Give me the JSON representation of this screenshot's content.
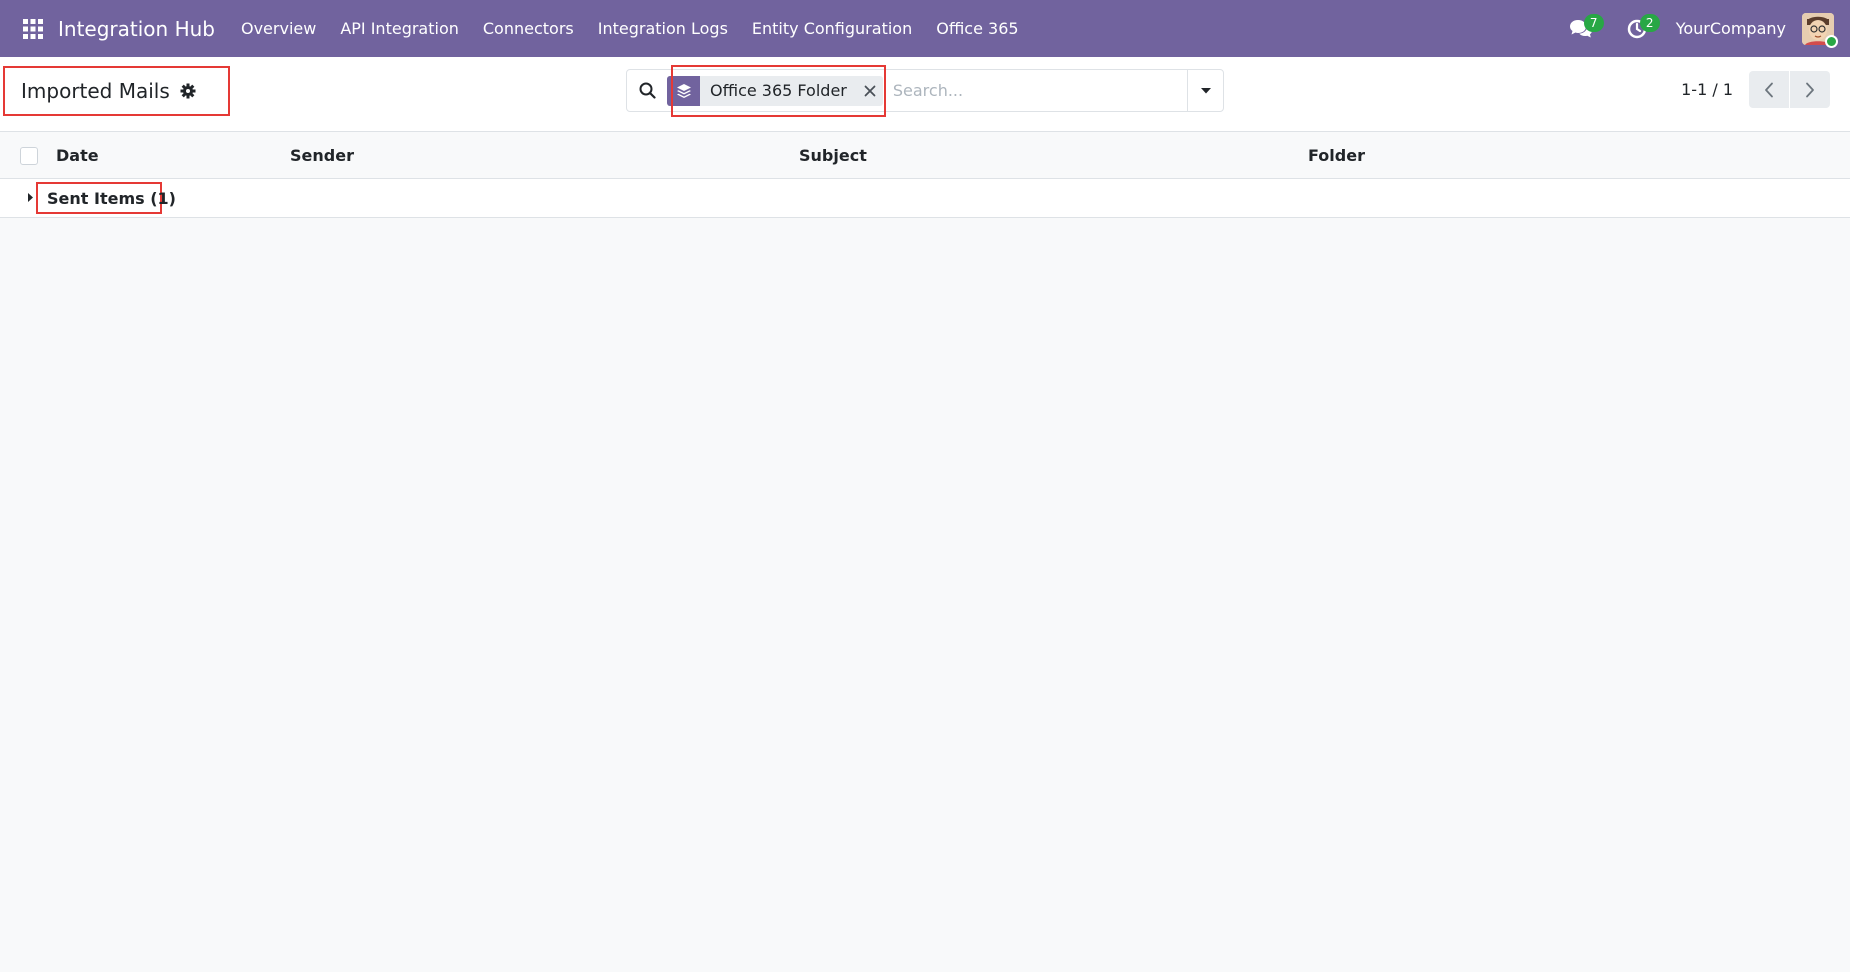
{
  "navbar": {
    "app_name": "Integration Hub",
    "menu": [
      "Overview",
      "API Integration",
      "Connectors",
      "Integration Logs",
      "Entity Configuration",
      "Office 365"
    ],
    "messages_count": "7",
    "activities_count": "2",
    "company": "YourCompany",
    "accent_color": "#71639e"
  },
  "control_panel": {
    "title": "Imported Mails",
    "search": {
      "facet_label": "Office 365 Folder",
      "facet_icon": "layers-icon",
      "placeholder": "Search..."
    },
    "pager": {
      "value": "1-1 / 1"
    }
  },
  "list": {
    "columns": [
      "Date",
      "Sender",
      "Subject",
      "Folder"
    ],
    "groups": [
      {
        "label": "Sent Items (1)"
      }
    ]
  }
}
